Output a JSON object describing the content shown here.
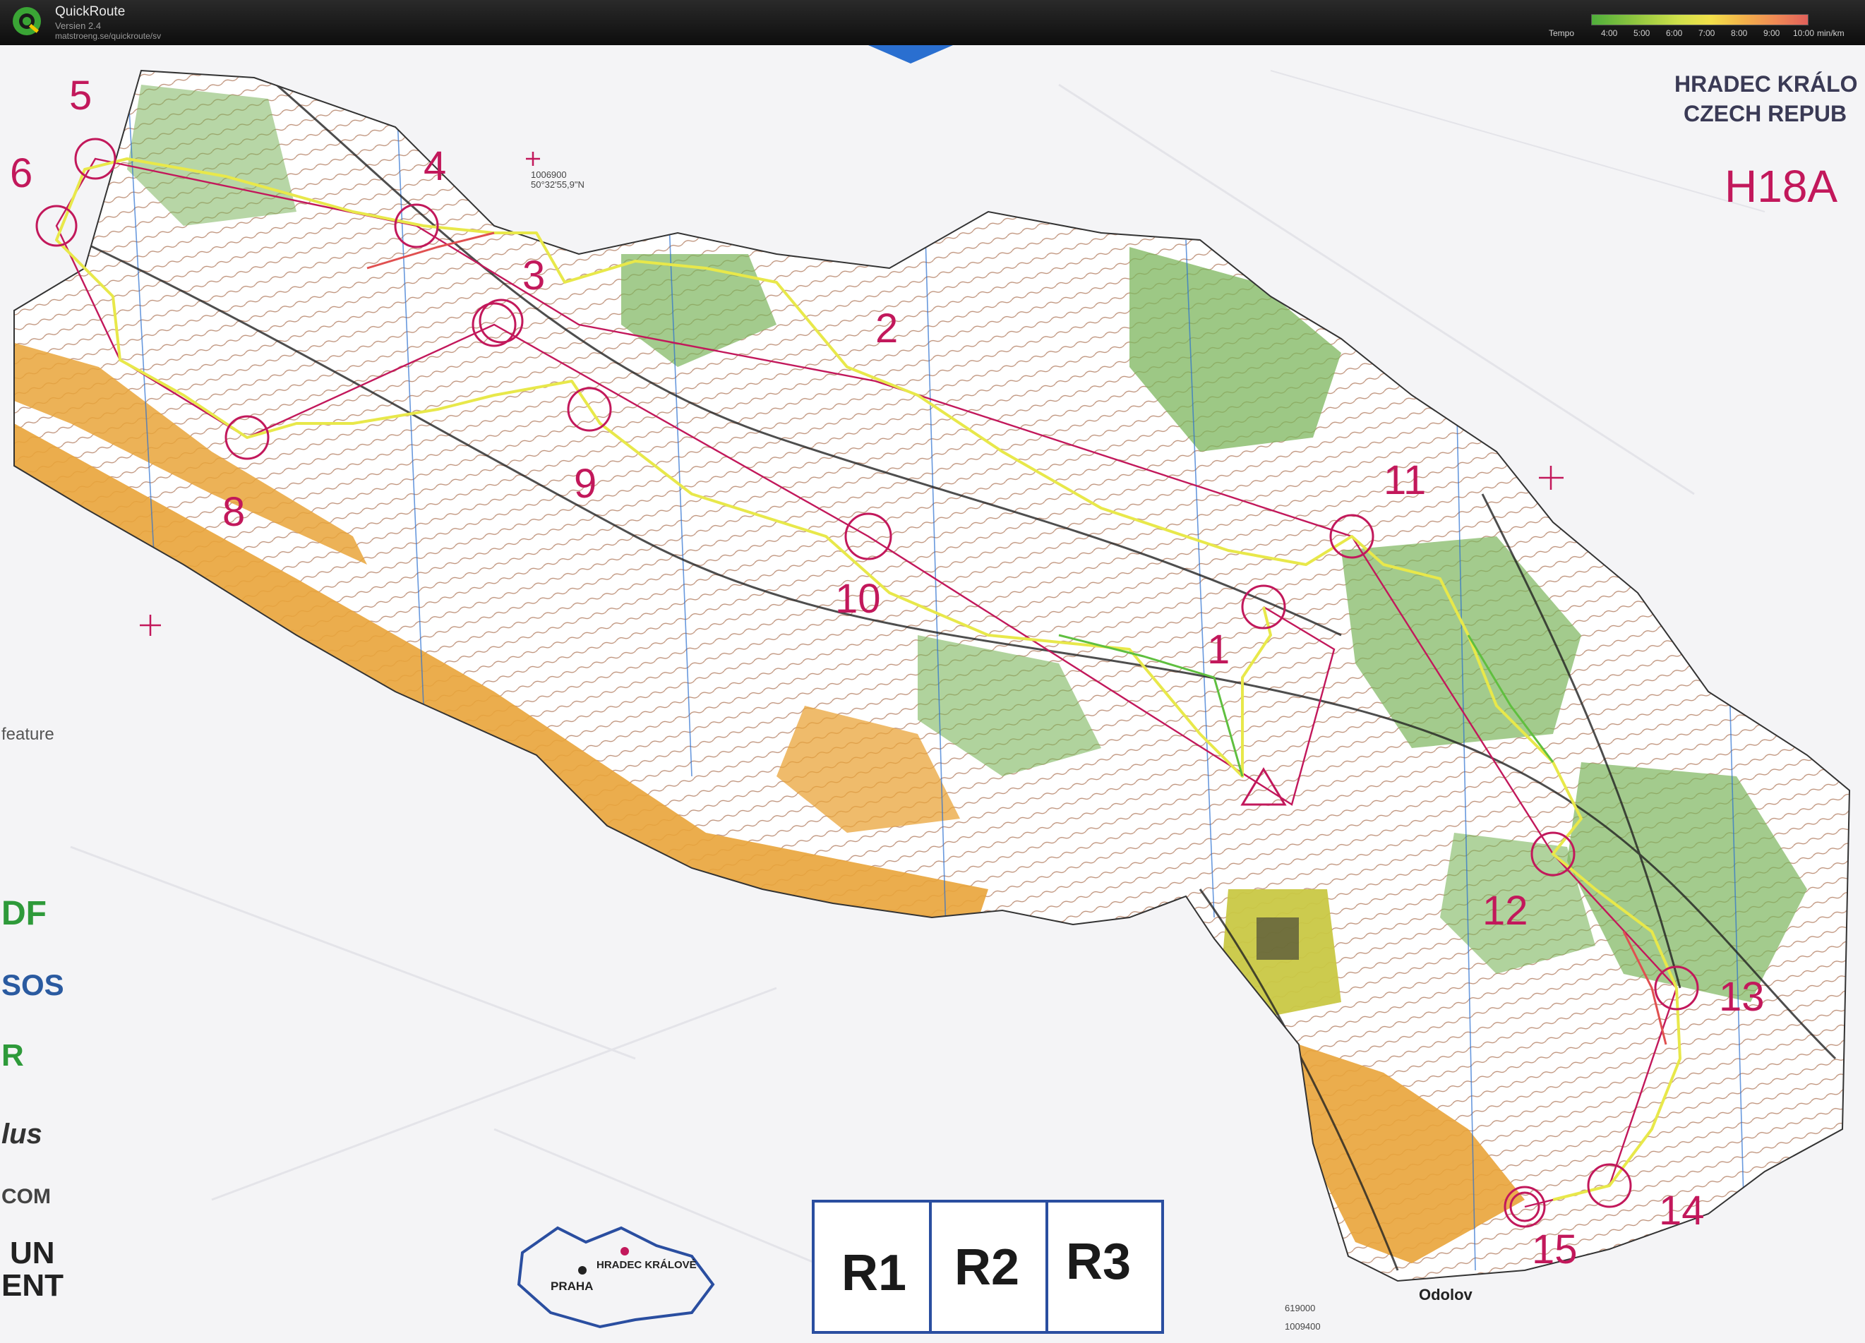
{
  "app": {
    "title": "QuickRoute",
    "version": "Versien 2.4",
    "url": "matstroeng.se/quickroute/sv"
  },
  "tempo": {
    "label": "Tempo",
    "ticks": [
      "4:00",
      "5:00",
      "6:00",
      "7:00",
      "8:00",
      "9:00",
      "10:00"
    ],
    "unit": "min/km"
  },
  "map": {
    "region_lines": [
      "HRADEC KRÁLO",
      "CZECH REPUB"
    ],
    "class_label": "H18A",
    "place_label": "Odolov",
    "feature_label": "feature",
    "controls": [
      "1",
      "2",
      "3",
      "4",
      "5",
      "6",
      "8",
      "9",
      "10",
      "11",
      "12",
      "13",
      "14",
      "15"
    ],
    "relay_boxes": [
      "R1",
      "R2",
      "R3"
    ],
    "inset_labels": [
      "PRAHA",
      "HRADEC KRÁLOVÉ"
    ],
    "coord_top": [
      "1006900",
      "50°32'55,9\"N"
    ],
    "coord_bottom": [
      "619000",
      "1009400"
    ],
    "sponsors": [
      "DF",
      "SOS",
      "R",
      "lus",
      "COM",
      "UN",
      "ENT"
    ],
    "colors": {
      "paper": "#f4f4f6",
      "forest_white": "#ffffff",
      "open_yellow": "#e9a43a",
      "green": "#7cb55c",
      "contour": "#9a5530",
      "course": "#c2185b",
      "route_yellow": "#e8e84a",
      "route_green": "#5fbf3f"
    }
  }
}
